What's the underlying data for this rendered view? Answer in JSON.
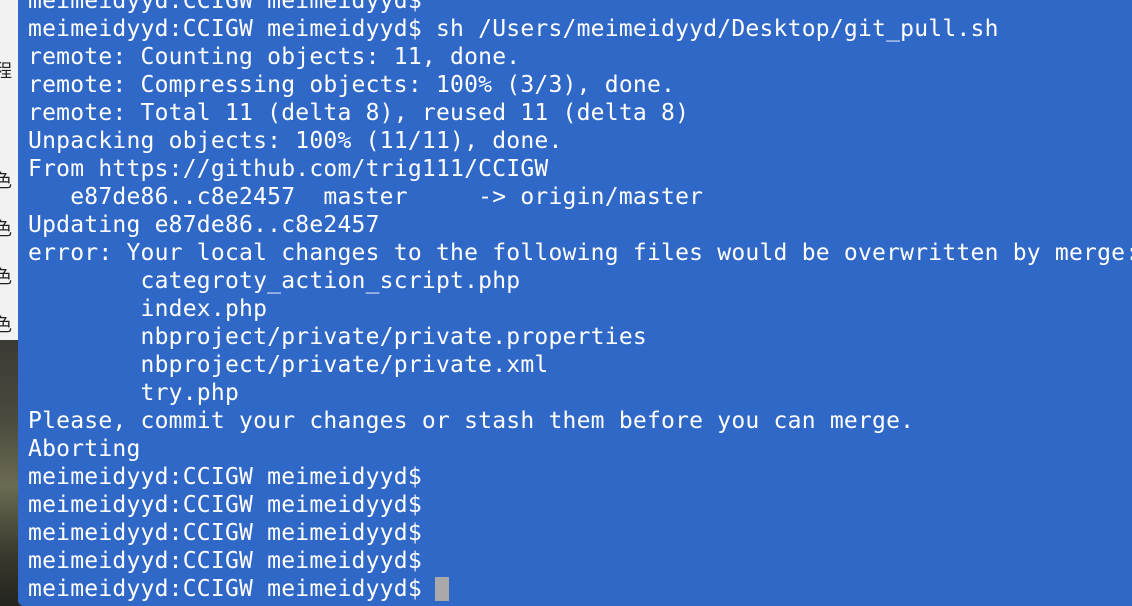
{
  "terminal": {
    "lines": [
      "meimeidyyd:CCIGW meimeidyyd$",
      "meimeidyyd:CCIGW meimeidyyd$ sh /Users/meimeidyyd/Desktop/git_pull.sh",
      "remote: Counting objects: 11, done.",
      "remote: Compressing objects: 100% (3/3), done.",
      "remote: Total 11 (delta 8), reused 11 (delta 8)",
      "Unpacking objects: 100% (11/11), done.",
      "From https://github.com/trig111/CCIGW",
      "   e87de86..c8e2457  master     -> origin/master",
      "Updating e87de86..c8e2457",
      "error: Your local changes to the following files would be overwritten by merge:",
      "\tcategroty_action_script.php",
      "\tindex.php",
      "\tnbproject/private/private.properties",
      "\tnbproject/private/private.xml",
      "\ttry.php",
      "Please, commit your changes or stash them before you can merge.",
      "Aborting",
      "meimeidyyd:CCIGW meimeidyyd$",
      "meimeidyyd:CCIGW meimeidyyd$",
      "meimeidyyd:CCIGW meimeidyyd$",
      "meimeidyyd:CCIGW meimeidyyd$"
    ],
    "prompt": "meimeidyyd:CCIGW meimeidyyd$",
    "background_color": "#2f68c7",
    "text_color": "#ffffff",
    "cursor_color": "#a9a9a9"
  },
  "background_window": {
    "visible_chars": [
      "程",
      "色",
      "色",
      "色",
      "色"
    ]
  }
}
